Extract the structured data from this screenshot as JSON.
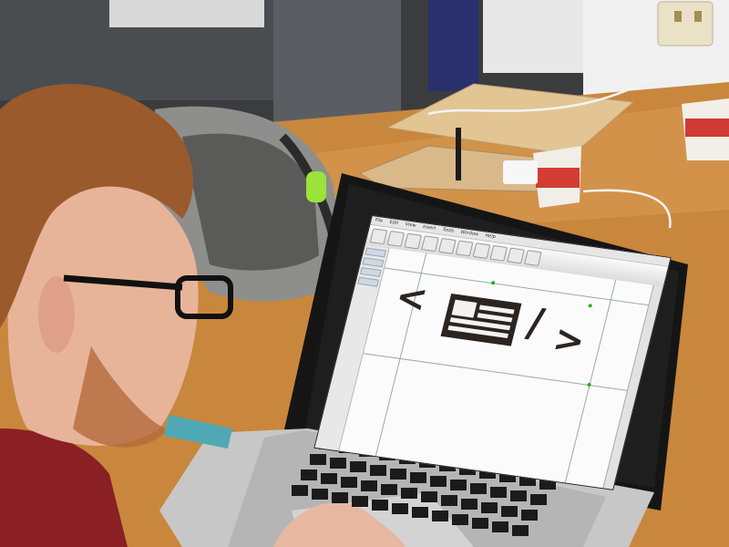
{
  "scene": {
    "description_tags": [
      "person",
      "laptop",
      "cad-software",
      "workshop-table"
    ],
    "colors": {
      "table": "#c9873d",
      "wall": "#3a3c3e",
      "shirt": "#8a1f24",
      "hair": "#9a5a2c",
      "skin": "#e7b49a",
      "laptop": "#c8c8c8",
      "screen_frame": "#1a1a1a",
      "design_ink": "#2b2420"
    }
  },
  "app": {
    "menu_items": [
      "File",
      "Edit",
      "View",
      "Insert",
      "Tools",
      "Window",
      "Help"
    ]
  },
  "design": {
    "left_symbol": "<",
    "slash_symbol": "/",
    "right_symbol": ">"
  }
}
